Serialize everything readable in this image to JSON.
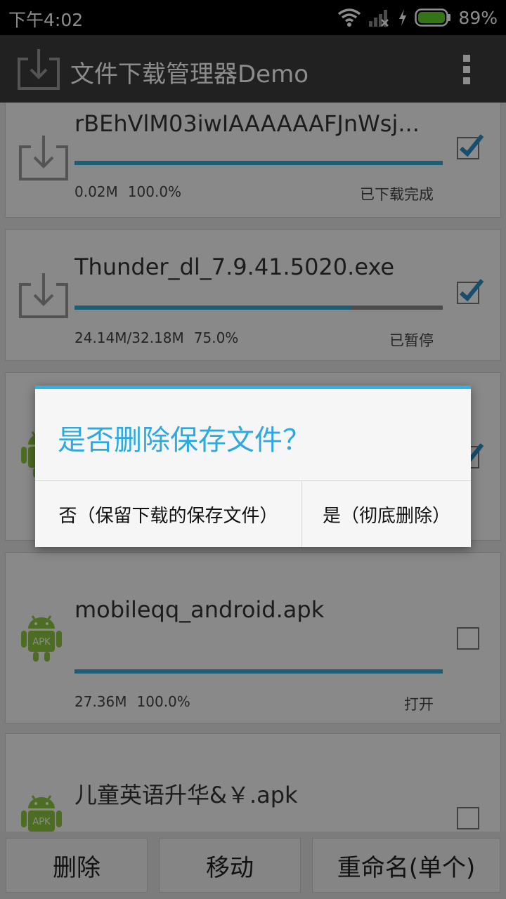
{
  "status_bar": {
    "time": "下午4:02",
    "battery_percent": "89%"
  },
  "action_bar": {
    "title": "文件下载管理器Demo"
  },
  "downloads": [
    {
      "name": "rBEhVlM03iwIAAAAAAFJnWsj...",
      "size": "0.02M",
      "percent": "100.0%",
      "status": "已下载完成",
      "progress": 1.0,
      "checked": true,
      "icon": "download-tray-icon"
    },
    {
      "name": "Thunder_dl_7.9.41.5020.exe",
      "size": "24.14M/32.18M",
      "percent": "75.0%",
      "status": "已暂停",
      "progress": 0.75,
      "checked": true,
      "icon": "download-tray-icon"
    },
    {
      "checked": true,
      "icon": "android-apk-icon"
    },
    {
      "name": "mobileqq_android.apk",
      "size": "27.36M",
      "percent": "100.0%",
      "status": "打开",
      "progress": 1.0,
      "checked": false,
      "icon": "android-apk-icon"
    },
    {
      "name": "儿童英语升华&￥.apk",
      "checked": false,
      "icon": "android-apk-icon"
    }
  ],
  "apk_badge_text": "APK",
  "bottom_actions": {
    "delete": "删除",
    "move": "移动",
    "rename": "重命名(单个)"
  },
  "dialog": {
    "title": "是否删除保存文件？",
    "negative": "否（保留下载的保存文件）",
    "positive": "是（彻底删除）"
  },
  "colors": {
    "accent": "#2fb1e8",
    "progress": "#37a9d9",
    "android_green": "#8cc63f"
  }
}
